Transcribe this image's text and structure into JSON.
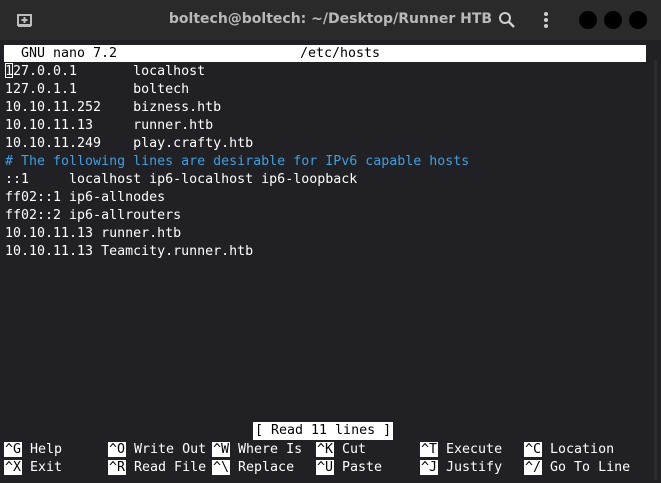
{
  "window": {
    "title": "boltech@boltech: ~/Desktop/Runner HTB"
  },
  "nano": {
    "version": "GNU nano 7.2",
    "filename": "/etc/hosts",
    "lines": [
      {
        "text": "127.0.0.1       localhost",
        "comment": false
      },
      {
        "text": "127.0.1.1       boltech",
        "comment": false
      },
      {
        "text": "10.10.11.252    bizness.htb",
        "comment": false
      },
      {
        "text": "10.10.11.13     runner.htb",
        "comment": false
      },
      {
        "text": "10.10.11.249    play.crafty.htb",
        "comment": false
      },
      {
        "text": "# The following lines are desirable for IPv6 capable hosts",
        "comment": true
      },
      {
        "text": "::1     localhost ip6-localhost ip6-loopback",
        "comment": false
      },
      {
        "text": "ff02::1 ip6-allnodes",
        "comment": false
      },
      {
        "text": "ff02::2 ip6-allrouters",
        "comment": false
      },
      {
        "text": "10.10.11.13 runner.htb",
        "comment": false
      },
      {
        "text": "10.10.11.13 Teamcity.runner.htb",
        "comment": false
      }
    ],
    "status": "[ Read 11 lines ]",
    "shortcuts": [
      {
        "key": "^G",
        "label": "Help"
      },
      {
        "key": "^O",
        "label": "Write Out"
      },
      {
        "key": "^W",
        "label": "Where Is"
      },
      {
        "key": "^K",
        "label": "Cut"
      },
      {
        "key": "^T",
        "label": "Execute"
      },
      {
        "key": "^C",
        "label": "Location"
      },
      {
        "key": "^X",
        "label": "Exit"
      },
      {
        "key": "^R",
        "label": "Read File"
      },
      {
        "key": "^\\",
        "label": "Replace"
      },
      {
        "key": "^U",
        "label": "Paste"
      },
      {
        "key": "^J",
        "label": "Justify"
      },
      {
        "key": "^/",
        "label": "Go To Line"
      }
    ]
  },
  "colors": {
    "comment": "#3f9fe0",
    "background": "#202025",
    "titlebar": "#2a2a2b"
  },
  "icons": {
    "new_tab": "new-tab-icon",
    "search": "search-icon",
    "menu": "kebab-menu-icon"
  }
}
